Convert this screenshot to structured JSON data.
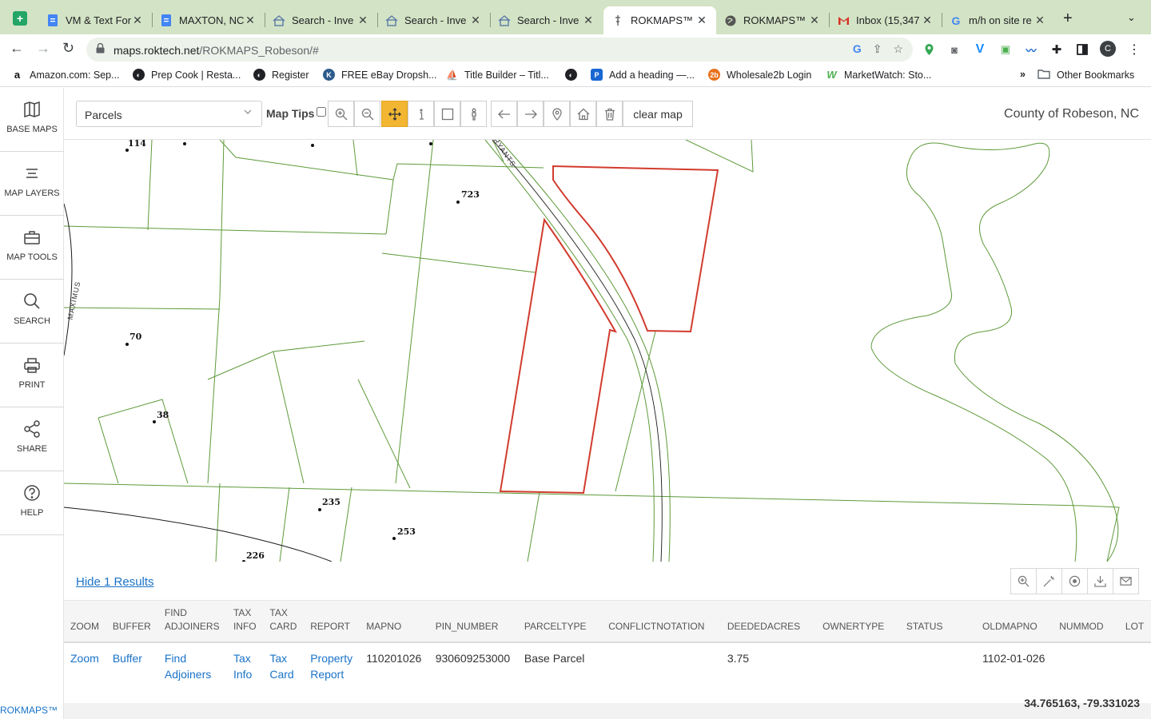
{
  "browser": {
    "tabs": [
      {
        "title": "VM & Text For",
        "icon": "docs-icon"
      },
      {
        "title": "MAXTON, NC",
        "icon": "docs-icon"
      },
      {
        "title": "Search - Inve",
        "icon": "house-icon"
      },
      {
        "title": "Search - Inve",
        "icon": "house-icon"
      },
      {
        "title": "Search - Inve",
        "icon": "house-icon"
      },
      {
        "title": "ROKMAPS™",
        "icon": "rokmaps-icon",
        "active": true
      },
      {
        "title": "ROKMAPS™",
        "icon": "globe-icon"
      },
      {
        "title": "Inbox (15,347",
        "icon": "gmail-icon"
      },
      {
        "title": "m/h on site re",
        "icon": "google-icon"
      }
    ],
    "url_host": "maps.roktech.net",
    "url_path": "/ROKMAPS_Robeson/#",
    "profile_initial": "C",
    "bookmarks": [
      {
        "label": "Amazon.com: Sep..."
      },
      {
        "label": "Prep Cook | Resta..."
      },
      {
        "label": "Register"
      },
      {
        "label": "FREE eBay Dropsh..."
      },
      {
        "label": "Title Builder – Titl..."
      },
      {
        "label": ""
      },
      {
        "label": "Add a heading —..."
      },
      {
        "label": "Wholesale2b Login"
      },
      {
        "label": "MarketWatch: Sto..."
      }
    ],
    "bookmarks_more": "»",
    "other_bookmarks": "Other Bookmarks"
  },
  "sidebar": {
    "items": [
      {
        "label": "BASE MAPS",
        "icon": "book-map-icon"
      },
      {
        "label": "MAP LAYERS",
        "icon": "layers-icon"
      },
      {
        "label": "MAP TOOLS",
        "icon": "toolbox-icon"
      },
      {
        "label": "SEARCH",
        "icon": "search-icon"
      },
      {
        "label": "PRINT",
        "icon": "printer-icon"
      },
      {
        "label": "SHARE",
        "icon": "share-icon"
      },
      {
        "label": "HELP",
        "icon": "help-icon"
      }
    ],
    "brand": "ROKMAPS™"
  },
  "toolbar": {
    "layer": "Parcels",
    "map_tips": "Map Tips",
    "clear_map": "clear map",
    "county": "County of Robeson, NC"
  },
  "map": {
    "parcel_numbers": [
      "114",
      "723",
      "70",
      "38",
      "235",
      "253",
      "226"
    ],
    "road_labels": [
      "MAXIMUS",
      "BRYANTS"
    ]
  },
  "results": {
    "toggle_label": "Hide 1 Results",
    "columns": [
      [
        "ZOOM"
      ],
      [
        "BUFFER"
      ],
      [
        "FIND",
        "ADJOINERS"
      ],
      [
        "TAX",
        "INFO"
      ],
      [
        "TAX",
        "CARD"
      ],
      [
        "REPORT"
      ],
      [
        "MAPNO"
      ],
      [
        "PIN_NUMBER"
      ],
      [
        "PARCELTYPE"
      ],
      [
        "CONFLICTNOTATION"
      ],
      [
        "DEEDEDACRES"
      ],
      [
        "OWNERTYPE"
      ],
      [
        "STATUS"
      ],
      [
        "OLDMAPNO"
      ],
      [
        "NUMMOD"
      ],
      [
        "LOT"
      ]
    ],
    "row": {
      "zoom": "Zoom",
      "buffer": "Buffer",
      "find_adjoiners": [
        "Find",
        "Adjoiners"
      ],
      "tax_info": [
        "Tax",
        "Info"
      ],
      "tax_card": [
        "Tax",
        "Card"
      ],
      "report": [
        "Property",
        "Report"
      ],
      "mapno": "110201026",
      "pin_number": "930609253000",
      "parceltype": "Base Parcel",
      "conflictnotation": "",
      "deededacres": "3.75",
      "ownertype": "",
      "status": "",
      "oldmapno": "1102-01-026",
      "nummod": "",
      "lot": ""
    }
  },
  "coordinates": "34.765163, -79.331023",
  "colors": {
    "parcel_line": "#5e9a3a",
    "selected_parcel": "#d23b2e",
    "active_tool": "#f2b632",
    "link": "#1a73c8"
  }
}
